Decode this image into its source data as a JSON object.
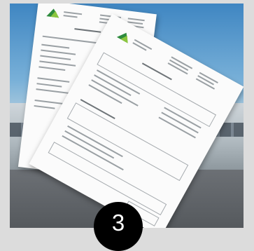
{
  "badge": {
    "number": "3"
  },
  "colors": {
    "logo_dark_green": "#2e8b3e",
    "logo_light_green": "#8cc63f",
    "badge_background": "#000000",
    "badge_text": "#ffffff"
  },
  "icons": [
    "company-logo-icon"
  ]
}
